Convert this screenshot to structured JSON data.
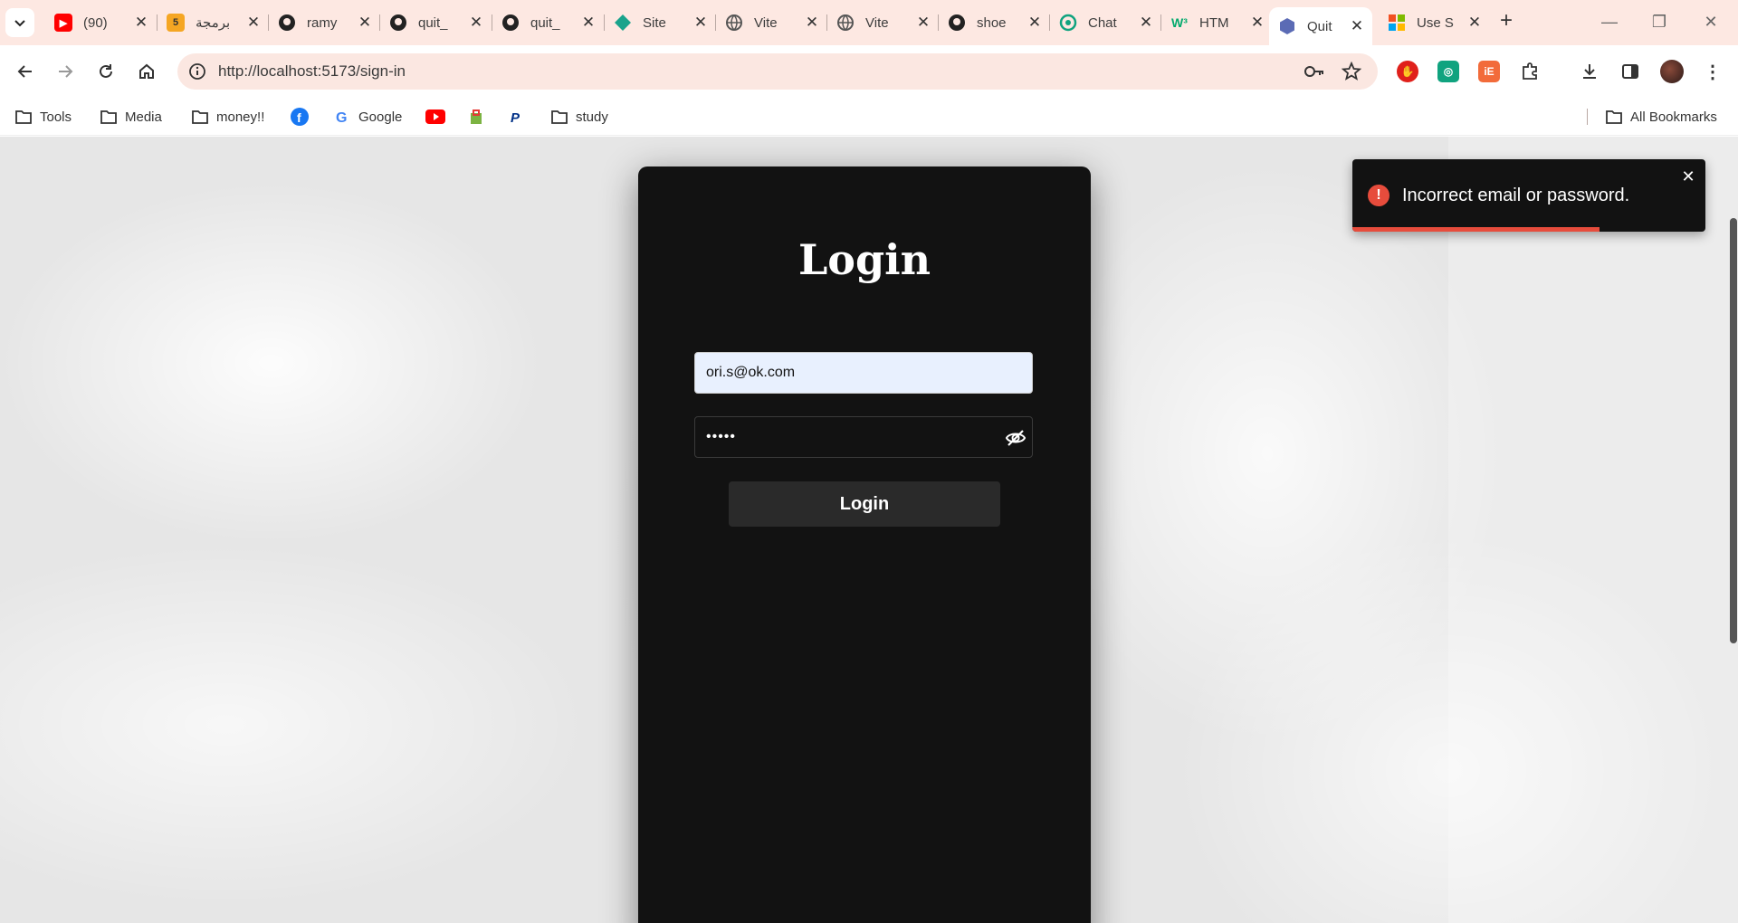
{
  "browser": {
    "tabs": [
      {
        "title": "(90)",
        "favicon": "youtube-icon",
        "color": "#ff0000"
      },
      {
        "title": "برمجة",
        "favicon": "five-icon",
        "color": "#f5a623"
      },
      {
        "title": "ramy",
        "favicon": "github-icon",
        "color": "#222222"
      },
      {
        "title": "quit_",
        "favicon": "github-icon",
        "color": "#222222"
      },
      {
        "title": "quit_",
        "favicon": "github-icon",
        "color": "#222222"
      },
      {
        "title": "Site",
        "favicon": "diamond-icon",
        "color": "#1aa38c"
      },
      {
        "title": "Vite",
        "favicon": "globe-icon",
        "color": "#555555"
      },
      {
        "title": "Vite",
        "favicon": "globe-icon",
        "color": "#555555"
      },
      {
        "title": "shoe",
        "favicon": "github-icon",
        "color": "#222222"
      },
      {
        "title": "Chat",
        "favicon": "chatgpt-icon",
        "color": "#10a37f"
      },
      {
        "title": "HTM",
        "favicon": "w3-icon",
        "color": "#04aa6d"
      },
      {
        "title": "Quit",
        "favicon": "hexagon-icon",
        "color": "#5b6bb5",
        "active": true
      },
      {
        "title": "Use S",
        "favicon": "microsoft-icon",
        "color": "#f25022"
      }
    ],
    "url": "http://localhost:5173/sign-in",
    "bookmarks": [
      {
        "label": "Tools",
        "icon": "folder-icon"
      },
      {
        "label": "Media",
        "icon": "folder-icon"
      },
      {
        "label": "money!!",
        "icon": "folder-icon"
      },
      {
        "label": "",
        "icon": "facebook-icon"
      },
      {
        "label": "Google",
        "icon": "google-icon"
      },
      {
        "label": "",
        "icon": "youtube-icon"
      },
      {
        "label": "",
        "icon": "shop-icon"
      },
      {
        "label": "",
        "icon": "paypal-icon"
      },
      {
        "label": "study",
        "icon": "folder-icon"
      }
    ],
    "all_bookmarks": "All Bookmarks"
  },
  "login": {
    "title": "Login",
    "email_value": "ori.s@ok.com",
    "password_value": "•••••",
    "button_label": "Login"
  },
  "toast": {
    "message": "Incorrect email or password.",
    "icon": "!",
    "close": "✕",
    "progress": 0.7,
    "color": "#e74c3c"
  }
}
